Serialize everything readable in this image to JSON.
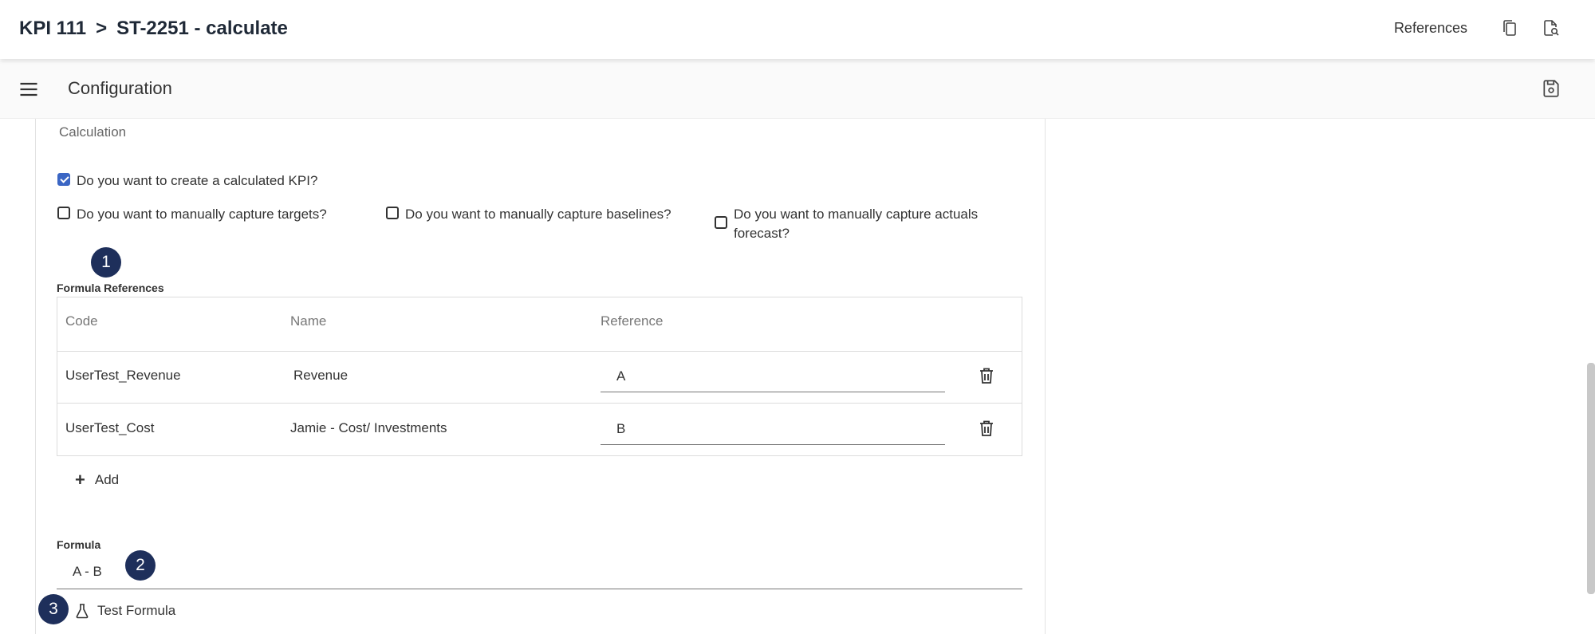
{
  "header": {
    "breadcrumb": [
      "KPI 111",
      ">",
      "ST-2251 - calculate"
    ],
    "references_label": "References",
    "copy_icon": "copy-icon",
    "search_document_icon": "document-search-icon"
  },
  "subheader": {
    "menu_icon": "hamburger-menu-icon",
    "title": "Configuration",
    "save_icon": "save-icon"
  },
  "calculation": {
    "section_label": "Calculation",
    "checkboxes": [
      {
        "label": "Do you want to create a calculated KPI?",
        "checked": true
      },
      {
        "label": "Do you want to manually capture targets?",
        "checked": false
      },
      {
        "label": "Do you want to manually capture baselines?",
        "checked": false
      },
      {
        "label_line1": "Do you want to manually capture actuals",
        "label_line2": "forecast?",
        "checked": false
      }
    ]
  },
  "badges": [
    "1",
    "2",
    "3"
  ],
  "formula_references": {
    "label": "Formula References",
    "columns": [
      "Code",
      "Name",
      "Reference"
    ],
    "rows": [
      {
        "code": "UserTest_Revenue",
        "name": "Revenue",
        "reference": "A"
      },
      {
        "code": "UserTest_Cost",
        "name": "Jamie - Cost/ Investments",
        "reference": "B"
      }
    ],
    "add_label": "Add"
  },
  "formula": {
    "label": "Formula",
    "value": "A - B",
    "test_label": "Test Formula"
  },
  "colors": {
    "accent": "#3b66c4",
    "badge": "#1e2f5b"
  }
}
